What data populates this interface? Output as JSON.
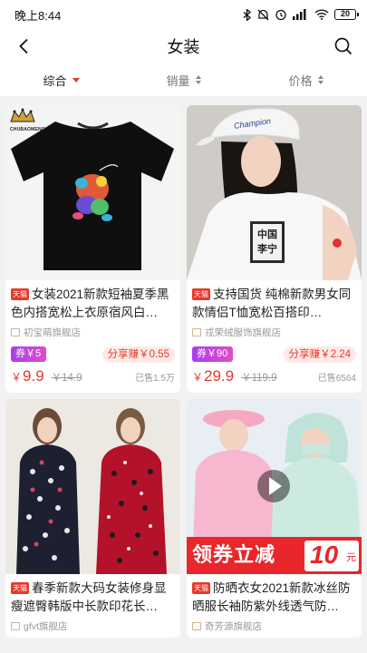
{
  "status": {
    "time": "晚上8:44",
    "battery": "20"
  },
  "nav": {
    "title": "女装"
  },
  "sort": {
    "items": [
      "综合",
      "销量",
      "价格"
    ]
  },
  "colors": {
    "accent": "#e5392b",
    "coupon": "#b33ee8"
  },
  "products": [
    {
      "title": "女装2021新款短袖夏季黑色内搭宽松上衣原宿风白…",
      "brand_mark": "CHUBAOMENG",
      "shop": "初宝萌旗舰店",
      "coupon": "券￥5",
      "share": "分享赚￥0.55",
      "price": "9.9",
      "orig": "￥14.9",
      "sold": "已售1.5万"
    },
    {
      "title": "支持国货 纯棉新款男女同款情侣T恤宽松百搭印…",
      "shop": "戎荣绒服饰旗舰店",
      "cap_text": "Champion",
      "shirt_text": "中国李宁",
      "coupon": "券￥90",
      "share": "分享赚￥2.24",
      "price": "29.9",
      "orig": "￥119.9",
      "sold": "已售6564"
    },
    {
      "title": "春季新款大码女装修身显瘦遮臀韩版中长款印花长…",
      "shop": "gfvt旗舰店"
    },
    {
      "title": "防晒衣女2021新款冰丝防晒服长袖防紫外线透气防…",
      "shop": "奇芳源旗舰店",
      "banner_text": "领券立减",
      "banner_num": "10",
      "banner_unit": "元"
    }
  ],
  "tmall_badge": "天猫",
  "yen": "￥"
}
